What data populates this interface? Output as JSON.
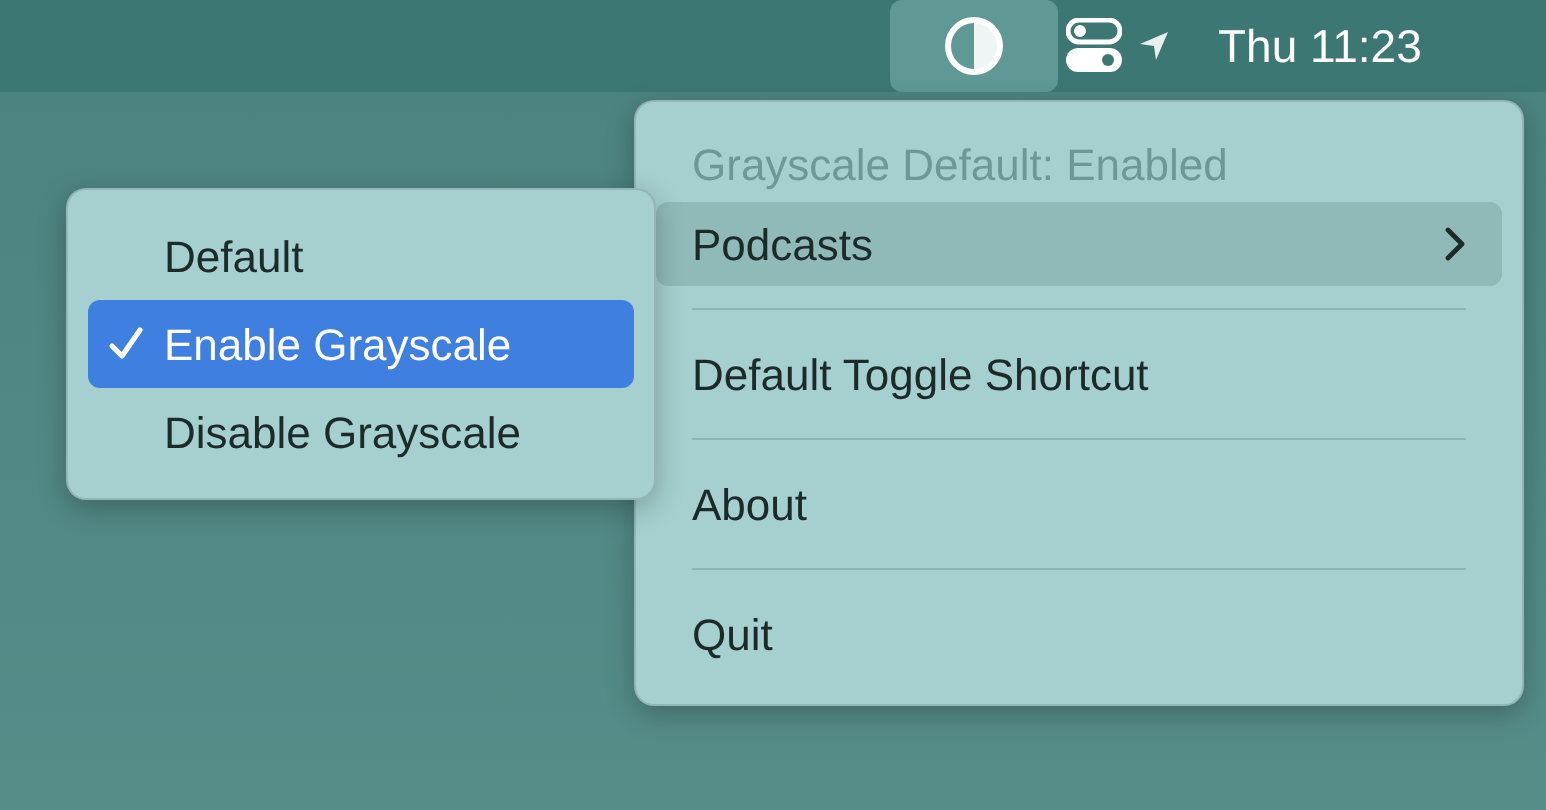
{
  "menu_bar": {
    "grayscale_icon_active": true,
    "clock": "Thu 11:23"
  },
  "menu": {
    "header": "Grayscale Default: Enabled",
    "items": [
      {
        "kind": "submenu",
        "label": "Podcasts",
        "selected": true
      },
      {
        "kind": "separator"
      },
      {
        "kind": "item",
        "label": "Default Toggle Shortcut",
        "selected": false
      },
      {
        "kind": "separator"
      },
      {
        "kind": "item",
        "label": "About",
        "selected": false
      },
      {
        "kind": "separator"
      },
      {
        "kind": "item",
        "label": "Quit",
        "selected": false
      }
    ]
  },
  "submenu": {
    "items": [
      {
        "label": "Default",
        "checked": false,
        "selected": false
      },
      {
        "label": "Enable Grayscale",
        "checked": true,
        "selected": true
      },
      {
        "label": "Disable Grayscale",
        "checked": false,
        "selected": false
      }
    ]
  }
}
